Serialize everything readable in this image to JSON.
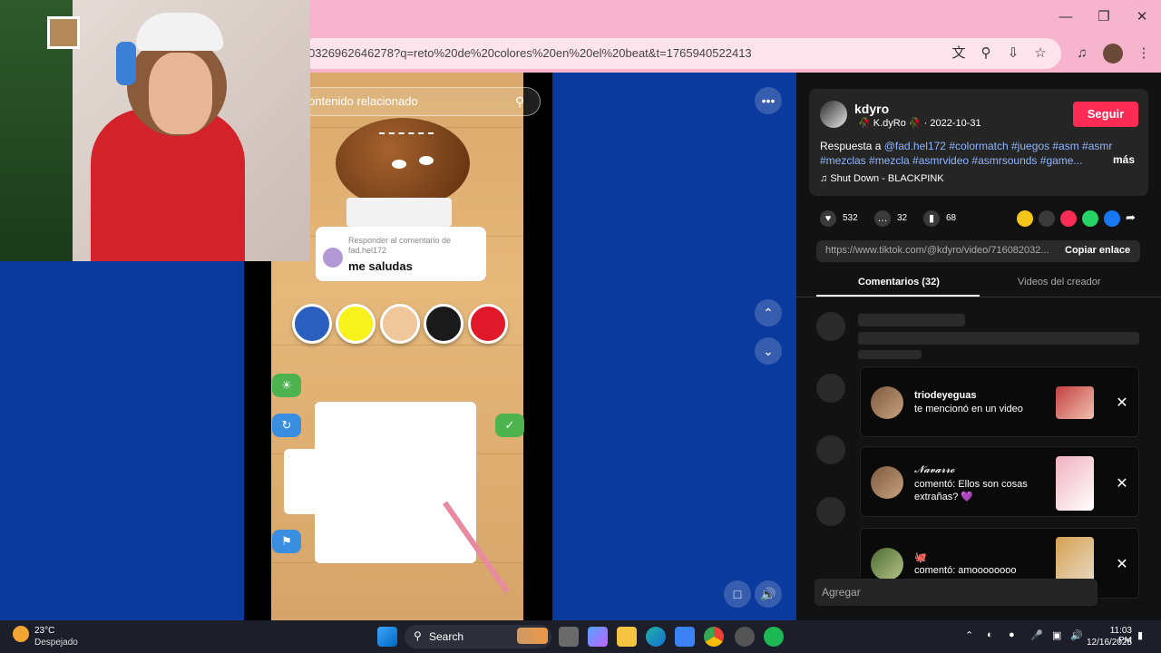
{
  "browser": {
    "url": "0326962646278?q=reto%20de%20colores%20en%20el%20beat&t=1765940522413",
    "window_controls": [
      "minimize-icon",
      "restore-icon",
      "close-icon"
    ]
  },
  "video": {
    "search_text": "ontenido relacionado",
    "comment_reply_label": "Responder al comentario de fad.hel172",
    "comment_text": "me saludas",
    "swatch_colors": [
      "#2b5fbf",
      "#f7f21c",
      "#efc79a",
      "#1a1a1a",
      "#e0182a"
    ]
  },
  "post": {
    "username": "kdyro",
    "display_name": "K.dyRo",
    "date": "2022-10-31",
    "follow_label": "Seguir",
    "caption_prefix": "Respuesta a",
    "caption_mention": "@fad.hel172",
    "caption_tags_line1": "#colormatch #juegos #asm #asmr",
    "caption_tags_line2": "#mezclas #mezcla #asmrvideo #asmrsounds #game...",
    "more_label": "más",
    "music": "Shut Down - BLACKPINK",
    "likes": "532",
    "comments": "32",
    "saves": "68",
    "link": "https://www.tiktok.com/@kdyro/video/716082032...",
    "copy_link_label": "Copiar enlace",
    "tab_comments": "Comentarios (32)",
    "tab_creator_videos": "Videos del creador",
    "comment_input_placeholder": "Agregar"
  },
  "notifications": [
    {
      "name": "triodeyeguas",
      "text": "te mencionó en un video"
    },
    {
      "name": "𝓝𝓪𝓿𝓪𝓻𝓻𝓸",
      "text": "comentó: Ellos son cosas extrañas? 💜"
    },
    {
      "name": "🐙",
      "text": "comentó: amoooooooo"
    }
  ],
  "taskbar": {
    "weather_temp": "23°C",
    "weather_desc": "Despejado",
    "search_label": "Search",
    "time": "11:03 PM",
    "date": "12/16/2025"
  },
  "colors": {
    "chrome_pink": "#f6b5cc",
    "page_blue": "#0b3a9e",
    "follow_red": "#fe2c55",
    "panel_bg": "#121212"
  }
}
